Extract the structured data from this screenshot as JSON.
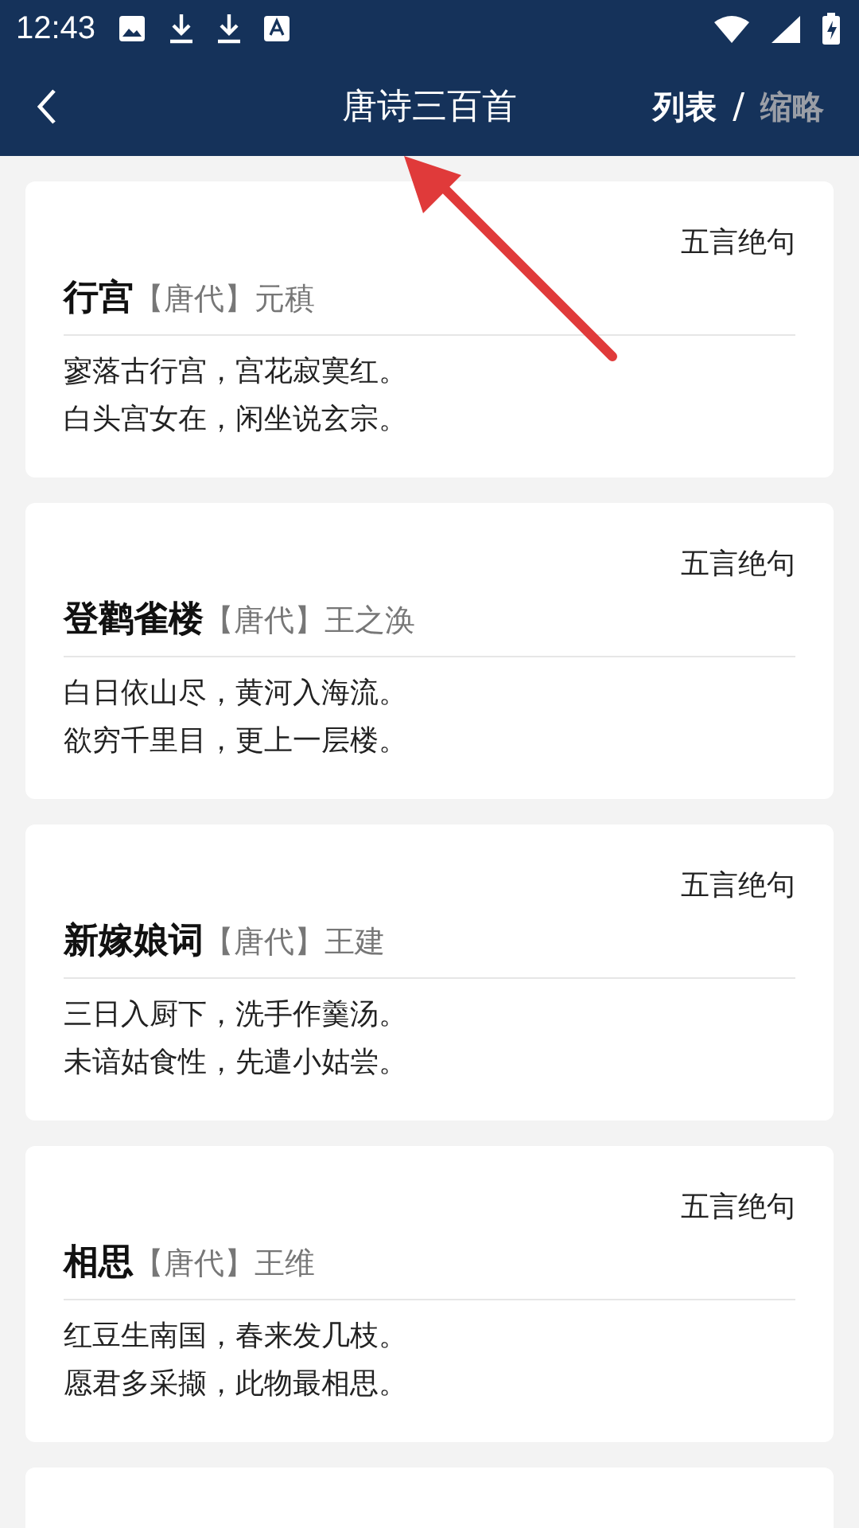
{
  "status_bar": {
    "time": "12:43"
  },
  "header": {
    "title": "唐诗三百首",
    "view_toggle": [
      {
        "label": "列表",
        "selected": true
      },
      {
        "label": "缩略",
        "selected": false
      }
    ],
    "separator": "/"
  },
  "poems": [
    {
      "form": "五言绝句",
      "title": "行宫",
      "dynasty": "【唐代】",
      "author": "元稹",
      "lines": [
        "寥落古行宫，宫花寂寞红。",
        "白头宫女在，闲坐说玄宗。"
      ]
    },
    {
      "form": "五言绝句",
      "title": "登鹳雀楼",
      "dynasty": "【唐代】",
      "author": "王之涣",
      "lines": [
        "白日依山尽，黄河入海流。",
        "欲穷千里目，更上一层楼。"
      ]
    },
    {
      "form": "五言绝句",
      "title": "新嫁娘词",
      "dynasty": "【唐代】",
      "author": "王建",
      "lines": [
        "三日入厨下，洗手作羹汤。",
        "未谙姑食性，先遣小姑尝。"
      ]
    },
    {
      "form": "五言绝句",
      "title": "相思",
      "dynasty": "【唐代】",
      "author": "王维",
      "lines": [
        "红豆生南国，春来发几枝。",
        "愿君多采撷，此物最相思。"
      ]
    }
  ]
}
